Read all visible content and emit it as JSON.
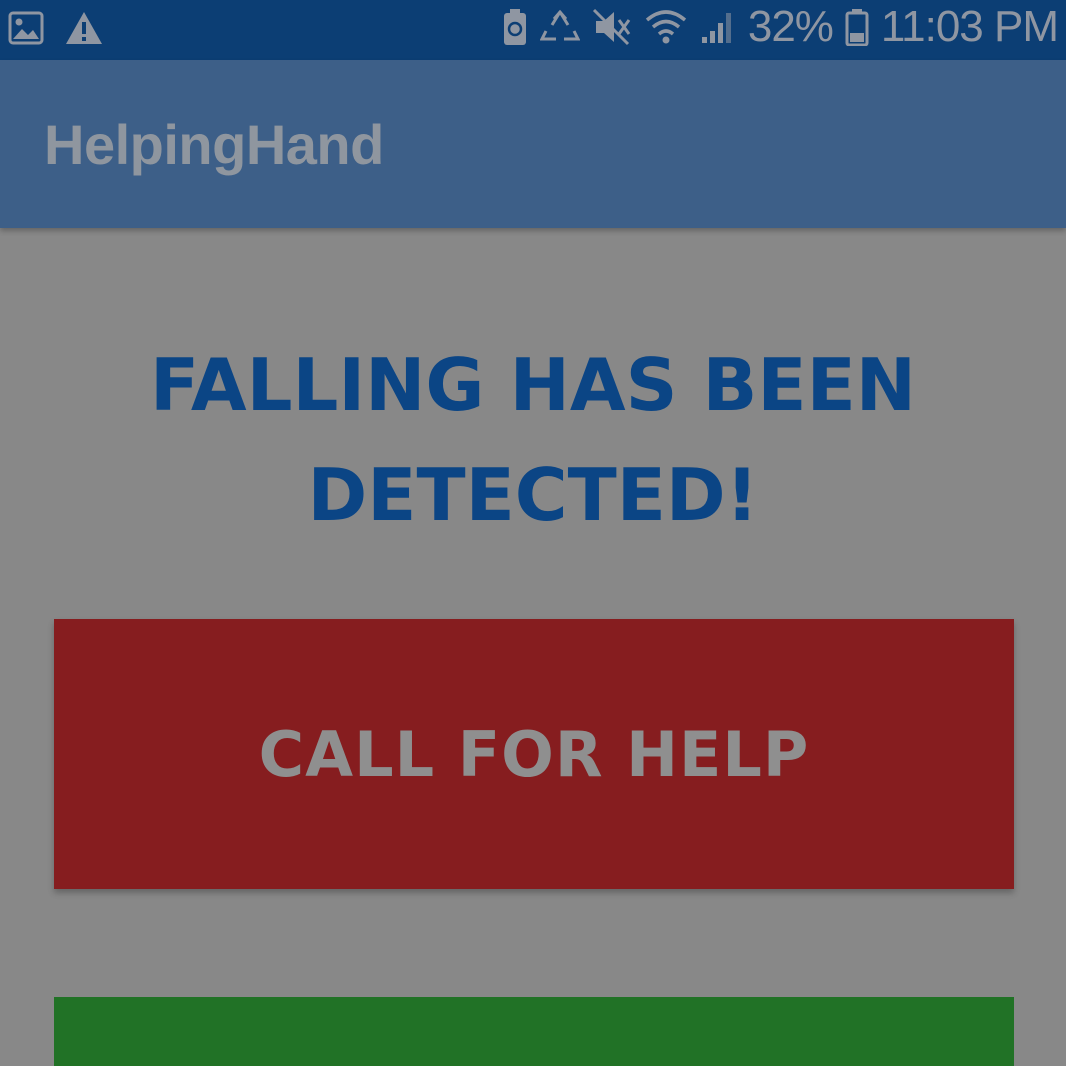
{
  "status_bar": {
    "battery_percent": "32%",
    "time": "11:03 PM",
    "icons": [
      "image-icon",
      "warning-icon",
      "battery-saver-icon",
      "recycle-icon",
      "mute-icon",
      "wifi-icon",
      "signal-icon",
      "battery-icon"
    ]
  },
  "app_bar": {
    "title": "HelpingHand"
  },
  "main": {
    "headline_line1": "FALLING HAS BEEN",
    "headline_line2": "DETECTED!",
    "call_button_label": "CALL FOR HELP"
  },
  "colors": {
    "status_bar": "#0c3e74",
    "app_bar": "#3d5f88",
    "background": "#888888",
    "headline": "#0b4585",
    "call_button": "#861d1f",
    "green_button": "#217226"
  }
}
